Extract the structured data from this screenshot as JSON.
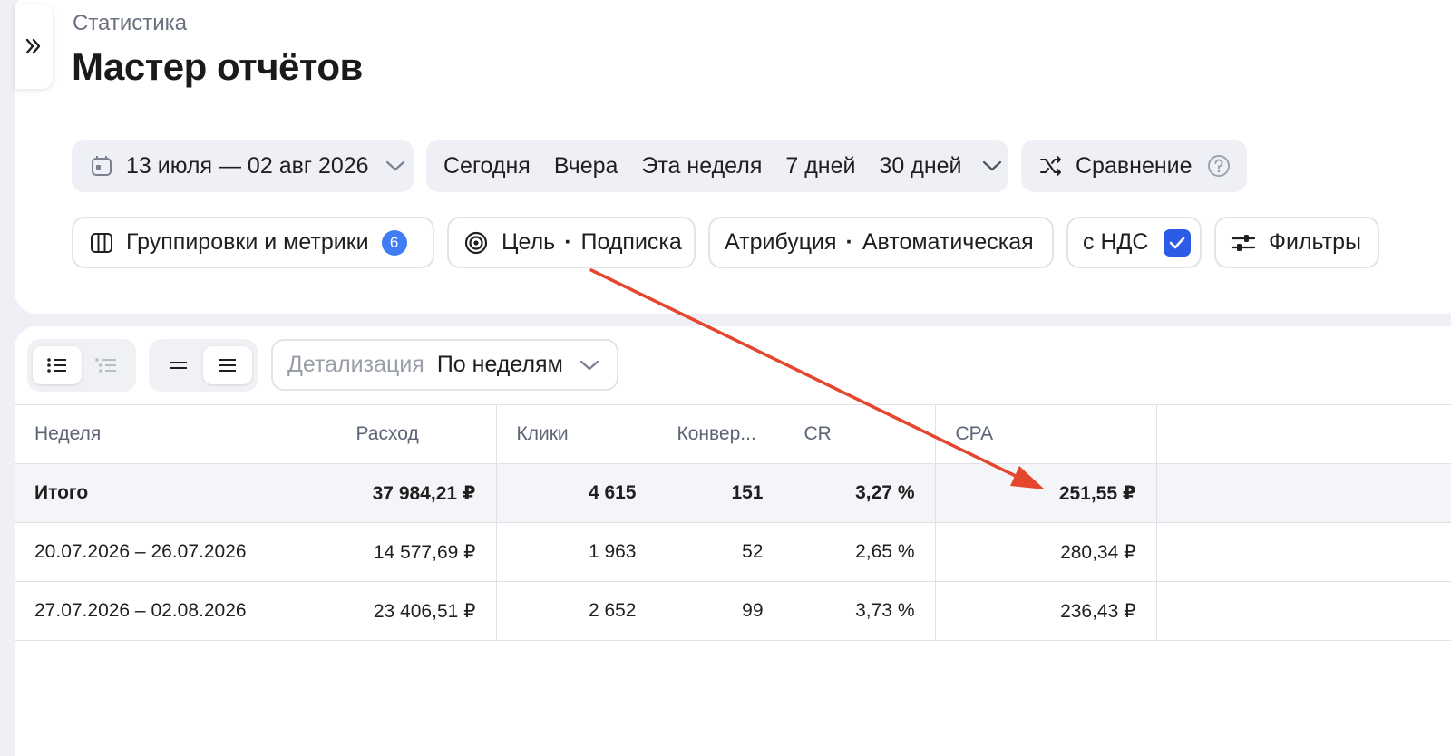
{
  "header": {
    "breadcrumb": "Статистика",
    "title": "Мастер отчётов"
  },
  "toolbar": {
    "date_range": "13 июля — 02 авг 2026",
    "presets": [
      "Сегодня",
      "Вчера",
      "Эта неделя",
      "7 дней",
      "30 дней"
    ],
    "compare_label": "Сравнение",
    "groupings_label": "Группировки и метрики",
    "groupings_count": "6",
    "goal_label": "Цель",
    "goal_value": "Подписка",
    "attribution_label": "Атрибуция",
    "attribution_value": "Автоматическая",
    "vat_label": "с НДС",
    "vat_checked": true,
    "filters_label": "Фильтры",
    "separator": "·"
  },
  "controls": {
    "detail_label": "Детализация",
    "detail_value": "По неделям"
  },
  "table": {
    "columns": [
      "Неделя",
      "Расход",
      "Клики",
      "Конвер...",
      "CR",
      "CPA"
    ],
    "total": [
      "Итого",
      "37 984,21 ₽",
      "4 615",
      "151",
      "3,27 %",
      "251,55 ₽"
    ],
    "rows": [
      [
        "20.07.2026 – 26.07.2026",
        "14 577,69 ₽",
        "1 963",
        "52",
        "2,65 %",
        "280,34 ₽"
      ],
      [
        "27.07.2026 – 02.08.2026",
        "23 406,51 ₽",
        "2 652",
        "99",
        "3,73 %",
        "236,43 ₽"
      ]
    ]
  },
  "colors": {
    "accent": "#2c5be5",
    "badge": "#3f7cf5",
    "annotation_arrow": "#e4472d"
  }
}
